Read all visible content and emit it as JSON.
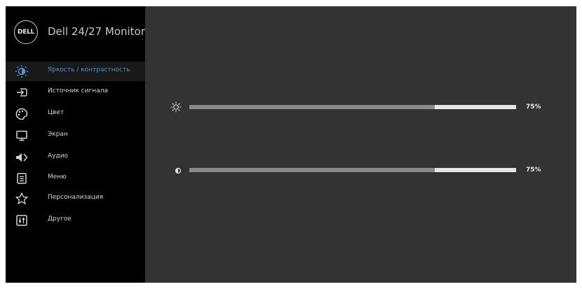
{
  "header": {
    "logo_text": "DELL",
    "title": "Dell 24/27 Monitor"
  },
  "menu": [
    {
      "label": "Яркость / контрастность",
      "icon": "brightness-icon",
      "active": true
    },
    {
      "label": "Источник сигнала",
      "icon": "input-source-icon",
      "active": false
    },
    {
      "label": "Цвет",
      "icon": "color-palette-icon",
      "active": false
    },
    {
      "label": "Экран",
      "icon": "display-icon",
      "active": false
    },
    {
      "label": "Аудио",
      "icon": "speaker-icon",
      "active": false
    },
    {
      "label": "Меню",
      "icon": "menu-list-icon",
      "active": false
    },
    {
      "label": "Персонализация",
      "icon": "star-icon",
      "active": false
    },
    {
      "label": "Другое",
      "icon": "other-settings-icon",
      "active": false
    }
  ],
  "sliders": [
    {
      "name": "brightness",
      "icon": "sun-icon",
      "value": 75,
      "value_text": "75%"
    },
    {
      "name": "contrast",
      "icon": "contrast-icon",
      "value": 75,
      "value_text": "75%"
    }
  ],
  "colors": {
    "accent": "#4a90d6",
    "sidebar_bg": "#000000",
    "panel_bg": "#333333",
    "slider_filled": "#8a8a8a",
    "slider_empty": "#e6e6e6"
  }
}
